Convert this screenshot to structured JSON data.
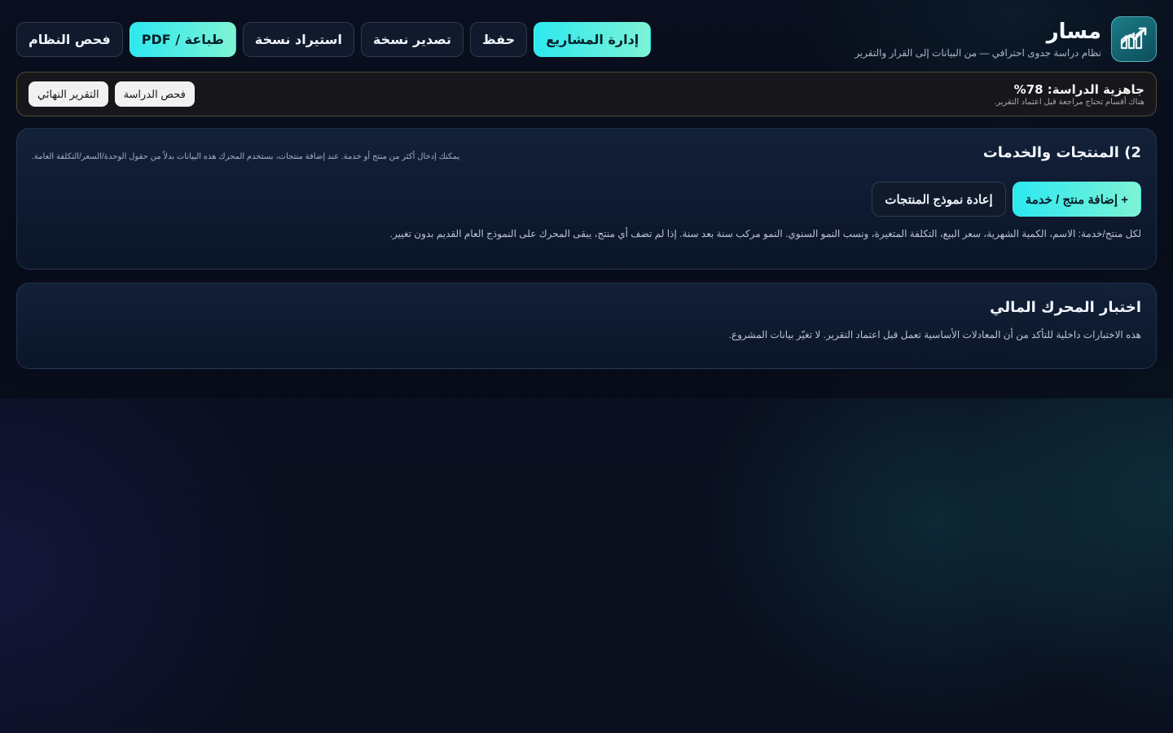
{
  "brand": {
    "title": "مسار",
    "subtitle": "نظام دراسة جدوى احترافي — من البيانات إلى القرار والتقرير",
    "logo_icon": "chart-growth-icon"
  },
  "toolbar": {
    "projects": "إدارة المشاريع",
    "save": "حفظ",
    "export": "تصدير نسخة",
    "import": "استيراد نسخة",
    "print": "طباعة / PDF",
    "system_check": "فحص النظام"
  },
  "readiness": {
    "title": "جاهزية الدراسة: 78%",
    "percent": 78,
    "note": "هناك أقسام تحتاج مراجعة قبل اعتماد التقرير.",
    "study_check": "فحص الدراسة",
    "final_report": "التقرير النهائي"
  },
  "products": {
    "title": "2) المنتجات والخدمات",
    "hint": "يمكنك إدخال أكثر من منتج أو خدمة. عند إضافة منتجات، يستخدم المحرك هذه البيانات بدلاً من حقول الوحدة/السعر/التكلفة العامة.",
    "add_button": "+ إضافة منتج / خدمة",
    "reset_button": "إعادة نموذج المنتجات",
    "description": "لكل منتج/خدمة: الاسم، الكمية الشهرية، سعر البيع، التكلفة المتغيرة، ونسب النمو السنوي. النمو مركب سنة بعد سنة. إذا لم تضف أي منتج، يبقى المحرك على النموذج العام القديم بدون تغيير."
  },
  "engine": {
    "title": "اختبار المحرك المالي",
    "description": "هذه الاختبارات داخلية للتأكد من أن المعادلات الأساسية تعمل قبل اعتماد التقرير. لا تغيّر بيانات المشروع."
  },
  "colors": {
    "accent_start": "#2de8f0",
    "accent_end": "#7ef3d4",
    "background": "#0a1020",
    "card": "#13233d"
  }
}
